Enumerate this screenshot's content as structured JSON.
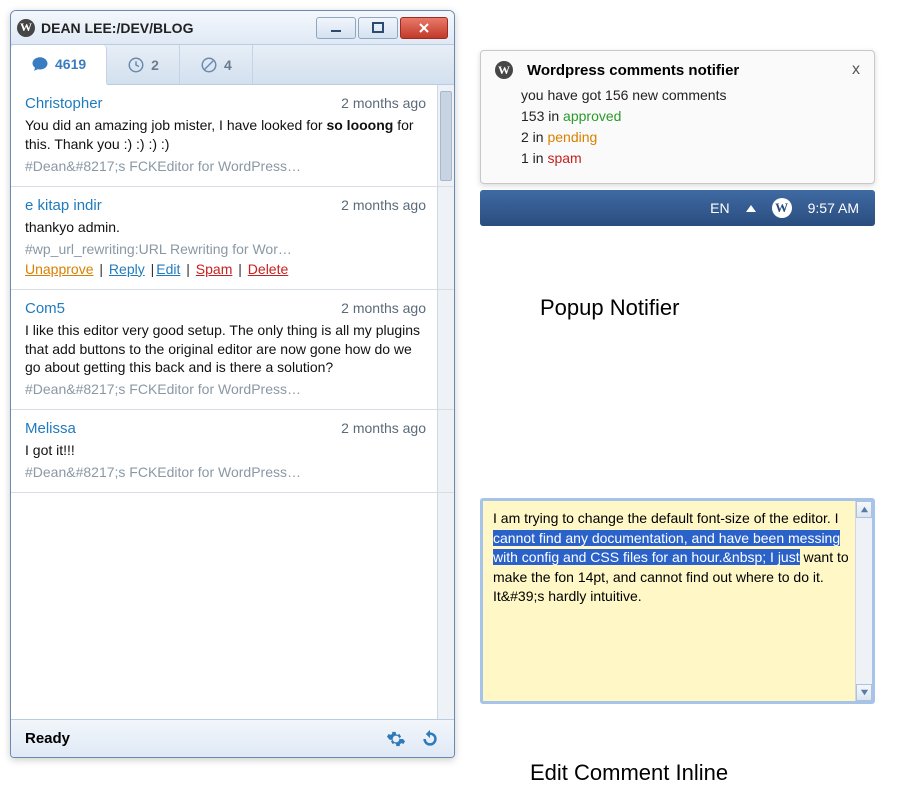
{
  "window": {
    "title": "DEAN LEE:/DEV/BLOG"
  },
  "tabs": {
    "comments_count": "4619",
    "pending_count": "2",
    "spam_count": "4"
  },
  "comments": [
    {
      "author": "Christopher",
      "time": "2 months ago",
      "body_pre": "You did an amazing job mister, I have looked for ",
      "body_bold": "so looong",
      "body_post": " for this. Thank you :) :) :) :)",
      "tag": "#Dean&#8217;s FCKEditor for WordPress…"
    },
    {
      "author": "e kitap indir",
      "time": "2 months ago",
      "body": "thankyo admin.",
      "tag": "#wp_url_rewriting:URL Rewriting for Wor…",
      "actions": {
        "unapprove": "Unapprove",
        "reply": "Reply",
        "edit": "Edit",
        "spam": "Spam",
        "delete": "Delete"
      }
    },
    {
      "author": "Com5",
      "time": "2 months ago",
      "body": "I like this editor very good setup.  The only thing is all my plugins that add buttons to the original editor are now gone how do we go about getting this back and is there a solution?",
      "tag": "#Dean&#8217;s FCKEditor for WordPress…"
    },
    {
      "author": "Melissa",
      "time": "2 months ago",
      "body": "I got it!!!",
      "tag": "#Dean&#8217;s FCKEditor for WordPress…"
    }
  ],
  "statusbar": {
    "text": "Ready"
  },
  "notifier": {
    "title": "Wordpress comments notifier",
    "line1": "you have got 156 new comments",
    "approved_count": "153 in ",
    "approved_label": "approved",
    "pending_count": "2 in ",
    "pending_label": "pending",
    "spam_count": "1 in ",
    "spam_label": "spam"
  },
  "taskbar": {
    "lang": "EN",
    "clock": "9:57 AM"
  },
  "captions": {
    "popup": "Popup Notifier",
    "inline": "Edit Comment Inline"
  },
  "inline_edit": {
    "pre": "I am trying to change the default font-size of the editor. I ",
    "selected": "cannot find any documentation, and have been messing with config and CSS files for an hour.&nbsp; I just",
    "post": " want to make the fon 14pt, and cannot find out where to do it. It&#39;s hardly intuitive."
  }
}
